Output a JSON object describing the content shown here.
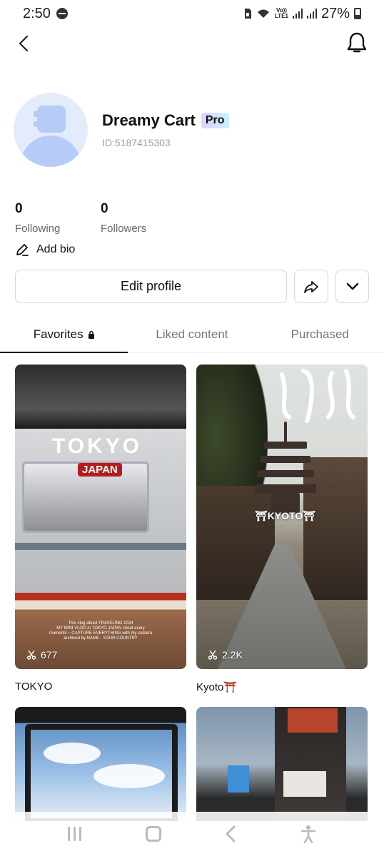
{
  "status_bar": {
    "time": "2:50",
    "battery_pct": "27%",
    "network_label_top": "Vo))",
    "network_label_bottom": "LTE1"
  },
  "header": {
    "back_icon": "chevron-left-icon",
    "bell_icon": "bell-icon"
  },
  "profile": {
    "name": "Dreamy Cart",
    "badge": "Pro",
    "id_text": "ID:5187415303",
    "avatar_colors": {
      "bg": "#e4ebfb",
      "fg": "#b6cbf6"
    }
  },
  "stats": [
    {
      "value": "0",
      "label": "Following"
    },
    {
      "value": "0",
      "label": "Followers"
    }
  ],
  "bio": {
    "label": "Add bio",
    "icon": "pencil-icon"
  },
  "buttons": {
    "edit_profile": "Edit profile",
    "share_icon": "share-arrow-icon",
    "more_icon": "chevron-down-icon"
  },
  "tabs": [
    {
      "label": "Favorites",
      "active": true,
      "locked": true
    },
    {
      "label": "Liked content",
      "active": false,
      "locked": false
    },
    {
      "label": "Purchased",
      "active": false,
      "locked": false
    }
  ],
  "grid": [
    {
      "title": "TOKYO",
      "count": "677",
      "overlay_title": "TOKYO",
      "overlay_badge": "JAPAN",
      "overlay_caption": "This vlog about TRAVELING 2024\nMY MINI VLOG in TOKYO JAPAN shoot every\nmoments ~ CAPTURE EVERYTHING with my camera\narchived by NAME - YOUR COUNTRY"
    },
    {
      "title": "Kyoto⛩️",
      "count": "2.2K",
      "overlay_label": "⛩KYOTO⛩"
    },
    {
      "title": "",
      "count": ""
    },
    {
      "title": "",
      "count": ""
    }
  ],
  "colors": {
    "accent": "#111111",
    "muted": "#777777",
    "border": "#d6d6d6"
  }
}
